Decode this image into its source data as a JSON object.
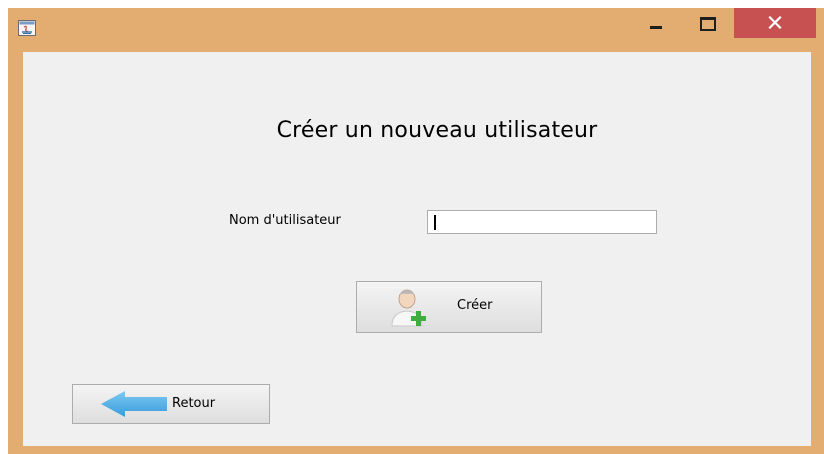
{
  "window": {
    "app_icon": "java-app-icon",
    "controls": {
      "minimize_icon": "minimize-icon",
      "maximize_icon": "maximize-icon",
      "close_icon": "close-icon"
    },
    "colors": {
      "titlebar": "#e3ad72",
      "close_button": "#c75050",
      "content": "#f0f0f0"
    }
  },
  "form": {
    "title": "Créer un nouveau utilisateur",
    "username_label": "Nom d'utilisateur",
    "username_value": "",
    "create_button_label": "Créer",
    "create_button_icon": "add-user-icon",
    "back_button_label": "Retour",
    "back_button_icon": "arrow-left-icon"
  }
}
